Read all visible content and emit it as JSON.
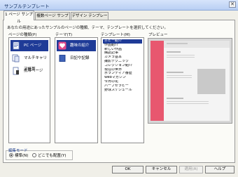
{
  "window": {
    "title": "サンプルテンプレート",
    "close_symbol": "✕"
  },
  "tabs": [
    {
      "label": "1 ページ サンプル",
      "active": true
    },
    {
      "label": "複数ページ サンプル",
      "active": false
    },
    {
      "label": "デザイン テンプレート",
      "active": false
    }
  ],
  "description": "あなたの用途にあったサンプルのページの種類、テーマ、テンプレートを選択してください。",
  "page_types": {
    "label": "ページの種類(P)",
    "items": [
      {
        "label": "PC ページ",
        "selected": true
      },
      {
        "label": "マルチキャリア携帯",
        "selected": false
      },
      {
        "label": "携帯ページ",
        "selected": false
      }
    ]
  },
  "themes": {
    "label": "テーマ(T)",
    "items": [
      {
        "label": "趣味の紹介",
        "selected": true,
        "color": "#e04a8c"
      },
      {
        "label": "日記や記録",
        "selected": false,
        "color": "#2b4c9a"
      }
    ]
  },
  "templates": {
    "label": "テンプレート(M)",
    "items": [
      {
        "label": "ホビー紹介",
        "selected": true
      },
      {
        "label": "作品紹介",
        "selected": false
      },
      {
        "label": "新しい作品",
        "selected": false
      },
      {
        "label": "購読記事",
        "selected": false
      },
      {
        "label": "カメラ基本",
        "selected": false
      },
      {
        "label": "撮影テクニック",
        "selected": false
      },
      {
        "label": "コレクション紹介",
        "selected": false
      },
      {
        "label": "現在の世界",
        "selected": false
      },
      {
        "label": "ボランティア番歴",
        "selected": false
      },
      {
        "label": "Webマガジン",
        "selected": false
      },
      {
        "label": "今月の花",
        "selected": false
      },
      {
        "label": "ハーブセラピー",
        "selected": false
      },
      {
        "label": "野球スケジュール",
        "selected": false
      }
    ]
  },
  "preview": {
    "label": "プレビュー",
    "accent": "#e8576f"
  },
  "edit_mode": {
    "label": "編集モード",
    "options": [
      {
        "label": "標準(N)",
        "selected": true
      },
      {
        "label": "どこでも配置(Y)",
        "selected": false
      }
    ]
  },
  "buttons": {
    "ok": "OK",
    "cancel": "キャンセル",
    "apply": "適用(A)",
    "help": "ヘルプ"
  }
}
